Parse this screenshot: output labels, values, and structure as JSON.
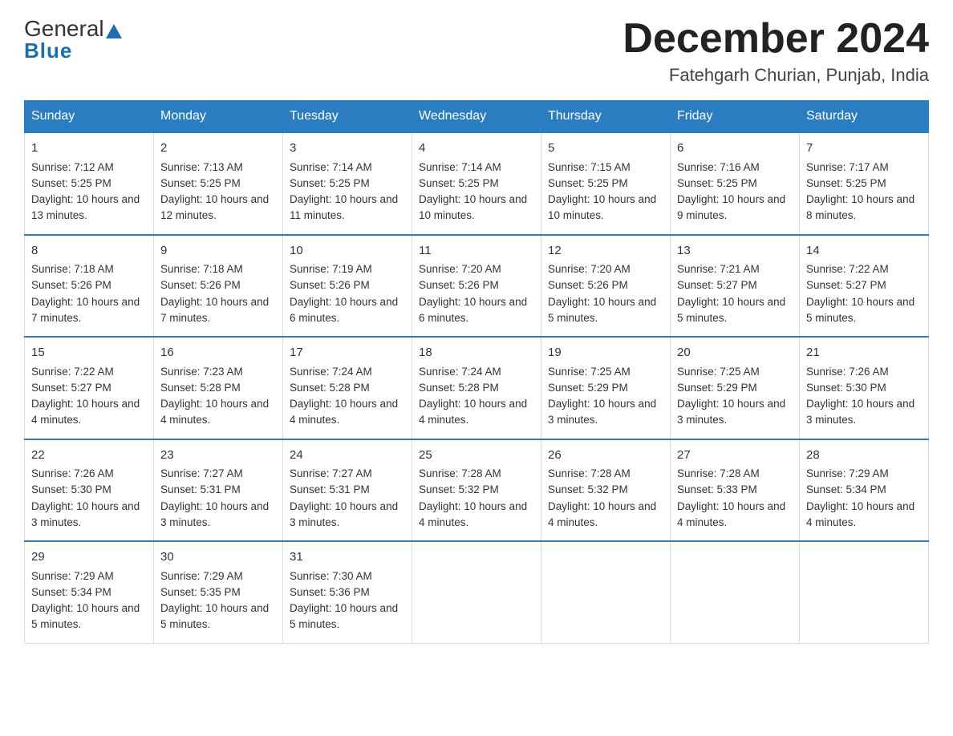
{
  "header": {
    "logo_general": "General",
    "logo_blue": "Blue",
    "main_title": "December 2024",
    "subtitle": "Fatehgarh Churian, Punjab, India"
  },
  "days_of_week": [
    "Sunday",
    "Monday",
    "Tuesday",
    "Wednesday",
    "Thursday",
    "Friday",
    "Saturday"
  ],
  "weeks": [
    [
      {
        "day": "1",
        "sunrise": "7:12 AM",
        "sunset": "5:25 PM",
        "daylight": "10 hours and 13 minutes."
      },
      {
        "day": "2",
        "sunrise": "7:13 AM",
        "sunset": "5:25 PM",
        "daylight": "10 hours and 12 minutes."
      },
      {
        "day": "3",
        "sunrise": "7:14 AM",
        "sunset": "5:25 PM",
        "daylight": "10 hours and 11 minutes."
      },
      {
        "day": "4",
        "sunrise": "7:14 AM",
        "sunset": "5:25 PM",
        "daylight": "10 hours and 10 minutes."
      },
      {
        "day": "5",
        "sunrise": "7:15 AM",
        "sunset": "5:25 PM",
        "daylight": "10 hours and 10 minutes."
      },
      {
        "day": "6",
        "sunrise": "7:16 AM",
        "sunset": "5:25 PM",
        "daylight": "10 hours and 9 minutes."
      },
      {
        "day": "7",
        "sunrise": "7:17 AM",
        "sunset": "5:25 PM",
        "daylight": "10 hours and 8 minutes."
      }
    ],
    [
      {
        "day": "8",
        "sunrise": "7:18 AM",
        "sunset": "5:26 PM",
        "daylight": "10 hours and 7 minutes."
      },
      {
        "day": "9",
        "sunrise": "7:18 AM",
        "sunset": "5:26 PM",
        "daylight": "10 hours and 7 minutes."
      },
      {
        "day": "10",
        "sunrise": "7:19 AM",
        "sunset": "5:26 PM",
        "daylight": "10 hours and 6 minutes."
      },
      {
        "day": "11",
        "sunrise": "7:20 AM",
        "sunset": "5:26 PM",
        "daylight": "10 hours and 6 minutes."
      },
      {
        "day": "12",
        "sunrise": "7:20 AM",
        "sunset": "5:26 PM",
        "daylight": "10 hours and 5 minutes."
      },
      {
        "day": "13",
        "sunrise": "7:21 AM",
        "sunset": "5:27 PM",
        "daylight": "10 hours and 5 minutes."
      },
      {
        "day": "14",
        "sunrise": "7:22 AM",
        "sunset": "5:27 PM",
        "daylight": "10 hours and 5 minutes."
      }
    ],
    [
      {
        "day": "15",
        "sunrise": "7:22 AM",
        "sunset": "5:27 PM",
        "daylight": "10 hours and 4 minutes."
      },
      {
        "day": "16",
        "sunrise": "7:23 AM",
        "sunset": "5:28 PM",
        "daylight": "10 hours and 4 minutes."
      },
      {
        "day": "17",
        "sunrise": "7:24 AM",
        "sunset": "5:28 PM",
        "daylight": "10 hours and 4 minutes."
      },
      {
        "day": "18",
        "sunrise": "7:24 AM",
        "sunset": "5:28 PM",
        "daylight": "10 hours and 4 minutes."
      },
      {
        "day": "19",
        "sunrise": "7:25 AM",
        "sunset": "5:29 PM",
        "daylight": "10 hours and 3 minutes."
      },
      {
        "day": "20",
        "sunrise": "7:25 AM",
        "sunset": "5:29 PM",
        "daylight": "10 hours and 3 minutes."
      },
      {
        "day": "21",
        "sunrise": "7:26 AM",
        "sunset": "5:30 PM",
        "daylight": "10 hours and 3 minutes."
      }
    ],
    [
      {
        "day": "22",
        "sunrise": "7:26 AM",
        "sunset": "5:30 PM",
        "daylight": "10 hours and 3 minutes."
      },
      {
        "day": "23",
        "sunrise": "7:27 AM",
        "sunset": "5:31 PM",
        "daylight": "10 hours and 3 minutes."
      },
      {
        "day": "24",
        "sunrise": "7:27 AM",
        "sunset": "5:31 PM",
        "daylight": "10 hours and 3 minutes."
      },
      {
        "day": "25",
        "sunrise": "7:28 AM",
        "sunset": "5:32 PM",
        "daylight": "10 hours and 4 minutes."
      },
      {
        "day": "26",
        "sunrise": "7:28 AM",
        "sunset": "5:32 PM",
        "daylight": "10 hours and 4 minutes."
      },
      {
        "day": "27",
        "sunrise": "7:28 AM",
        "sunset": "5:33 PM",
        "daylight": "10 hours and 4 minutes."
      },
      {
        "day": "28",
        "sunrise": "7:29 AM",
        "sunset": "5:34 PM",
        "daylight": "10 hours and 4 minutes."
      }
    ],
    [
      {
        "day": "29",
        "sunrise": "7:29 AM",
        "sunset": "5:34 PM",
        "daylight": "10 hours and 5 minutes."
      },
      {
        "day": "30",
        "sunrise": "7:29 AM",
        "sunset": "5:35 PM",
        "daylight": "10 hours and 5 minutes."
      },
      {
        "day": "31",
        "sunrise": "7:30 AM",
        "sunset": "5:36 PM",
        "daylight": "10 hours and 5 minutes."
      },
      null,
      null,
      null,
      null
    ]
  ]
}
